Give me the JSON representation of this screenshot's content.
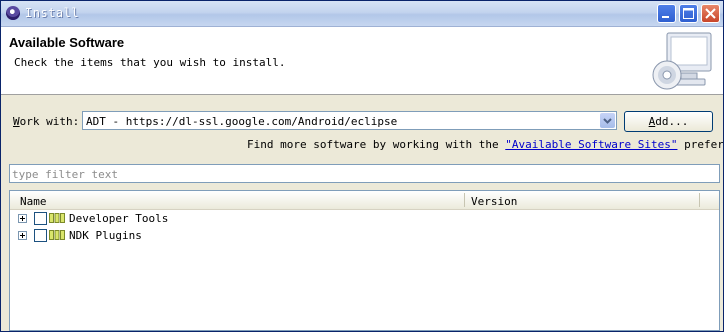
{
  "window": {
    "title": "Install"
  },
  "header": {
    "title": "Available Software",
    "description": "Check the items that you wish to install."
  },
  "work_with": {
    "label_accel": "W",
    "label_rest": "ork with:",
    "value": "ADT - https://dl-ssl.google.com/Android/eclipse",
    "add_accel": "A",
    "add_rest": "dd..."
  },
  "find_more": {
    "prefix": "Find more software by working with the ",
    "link": "\"Available Software Sites\"",
    "suffix": " preferences."
  },
  "filter": {
    "placeholder": "type filter text"
  },
  "tree": {
    "columns": [
      "Name",
      "Version"
    ],
    "rows": [
      {
        "label": "Developer Tools",
        "checked": false,
        "icon": "feature-icon"
      },
      {
        "label": "NDK Plugins",
        "checked": false,
        "icon": "feature-icon"
      }
    ]
  },
  "icons": {
    "window": "eclipse-icon",
    "header": "install-computer-cd-icon",
    "combo": "chevron-down-icon",
    "row": "feature-icon"
  }
}
